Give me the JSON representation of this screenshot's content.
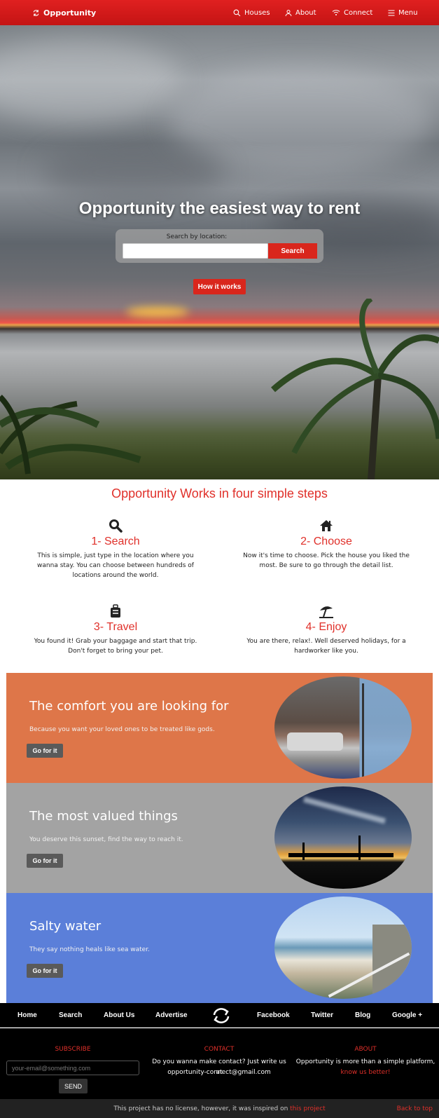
{
  "nav": {
    "brand": "Opportunity",
    "items": [
      {
        "label": "Houses",
        "icon": "search-icon"
      },
      {
        "label": "About",
        "icon": "user-icon"
      },
      {
        "label": "Connect",
        "icon": "wifi-icon"
      },
      {
        "label": "Menu",
        "icon": "hamburger-icon"
      }
    ]
  },
  "hero": {
    "title": "Opportunity the easiest way to rent",
    "search_label": "Search by location:",
    "search_value": "",
    "search_button": "Search",
    "how_button": "How it works"
  },
  "steps": {
    "title": "Opportunity Works in four simple steps",
    "items": [
      {
        "heading": "1- Search",
        "icon": "magnifier-icon",
        "text": "This is simple, just type in the location where you wanna stay. You can choose between hundreds of locations around the world."
      },
      {
        "heading": "2- Choose",
        "icon": "house-icon",
        "text": "Now it's time to choose. Pick the house you liked the most. Be sure to go through the detail list."
      },
      {
        "heading": "3- Travel",
        "icon": "suitcase-icon",
        "text": "You found it! Grab your baggage and start that trip. Don't forget to bring your pet."
      },
      {
        "heading": "4- Enjoy",
        "icon": "beach-umbrella-icon",
        "text": "You are there, relax!. Well deserved holidays, for a hardworker like you."
      }
    ]
  },
  "features": [
    {
      "title": "The comfort you are looking for",
      "text": "Because you want your loved ones to be treated like gods.",
      "button": "Go for it",
      "color": "#de7649"
    },
    {
      "title": "The most valued things",
      "text": "You deserve this sunset, find the way to reach it.",
      "button": "Go for it",
      "color": "#a3a3a3"
    },
    {
      "title": "Salty water",
      "text": "They say nothing heals like sea water.",
      "button": "Go for it",
      "color": "#5b7fd9"
    }
  ],
  "footer_nav": {
    "items": [
      "Home",
      "Search",
      "About Us",
      "Advertise",
      "Facebook",
      "Twitter",
      "Blog",
      "Google +"
    ]
  },
  "footer": {
    "subscribe": {
      "title": "SUBSCRIBE",
      "placeholder": "your-email@something.com",
      "button": "SEND"
    },
    "contact": {
      "title": "CONTACT",
      "line1": "Do you wanna make contact? Just write us at",
      "line2": "opportunity-connect@gmail.com"
    },
    "about": {
      "title": "ABOUT",
      "line1": "Opportunity is more than a simple platform,",
      "link": "know us better!"
    }
  },
  "bottom": {
    "text": "This project has no license, however, it was inspired on",
    "link": "this project",
    "back_to_top": "Back to top"
  }
}
